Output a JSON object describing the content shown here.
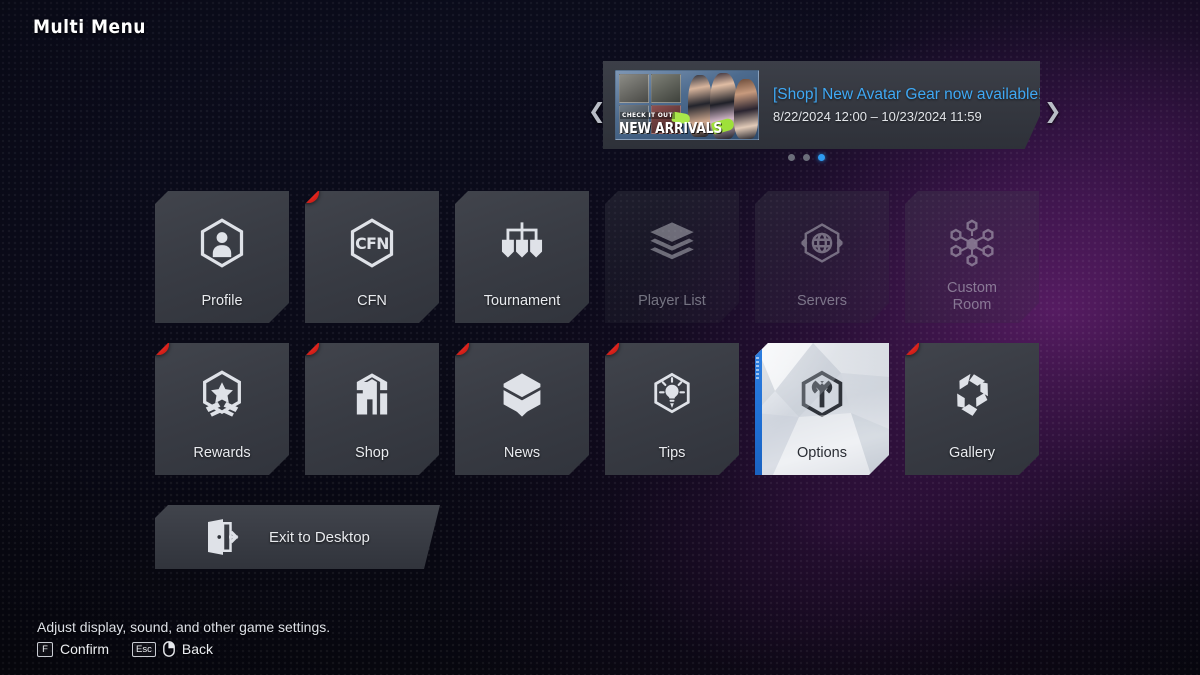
{
  "page": {
    "title": "Multi Menu"
  },
  "banner": {
    "title": "[Shop] New Avatar Gear now available!",
    "date_range": "8/22/2024 12:00 – 10/23/2024 11:59",
    "thumb_kicker": "CHECK IT OUT",
    "thumb_title": "NEW ARRIVALS",
    "prev_icon": "chevron-left-icon",
    "next_icon": "chevron-right-icon",
    "dots": [
      {
        "active": false
      },
      {
        "active": false
      },
      {
        "active": true
      }
    ],
    "accent_color": "#3fa9f5"
  },
  "grid": {
    "row1": [
      {
        "label": "Profile",
        "icon": "profile-icon",
        "state": "enabled",
        "badge": false
      },
      {
        "label": "CFN",
        "icon": "cfn-icon",
        "state": "enabled",
        "badge": true
      },
      {
        "label": "Tournament",
        "icon": "tournament-icon",
        "state": "enabled",
        "badge": false
      },
      {
        "label": "Player List",
        "icon": "player-list-icon",
        "state": "disabled",
        "badge": false
      },
      {
        "label": "Servers",
        "icon": "servers-icon",
        "state": "disabled",
        "badge": false
      },
      {
        "label": "Custom\nRoom",
        "label_line1": "Custom",
        "label_line2": "Room",
        "icon": "custom-room-icon",
        "state": "disabled",
        "badge": false
      }
    ],
    "row2": [
      {
        "label": "Rewards",
        "icon": "rewards-icon",
        "state": "enabled",
        "badge": true
      },
      {
        "label": "Shop",
        "icon": "shop-icon",
        "state": "enabled",
        "badge": true
      },
      {
        "label": "News",
        "icon": "news-icon",
        "state": "enabled",
        "badge": true
      },
      {
        "label": "Tips",
        "icon": "tips-icon",
        "state": "enabled",
        "badge": true
      },
      {
        "label": "Options",
        "icon": "options-icon",
        "state": "selected",
        "badge": false
      },
      {
        "label": "Gallery",
        "icon": "gallery-icon",
        "state": "enabled",
        "badge": true
      }
    ]
  },
  "exit": {
    "label": "Exit to Desktop",
    "icon": "exit-door-icon"
  },
  "footer": {
    "description": "Adjust display, sound, and other game settings.",
    "hints": [
      {
        "key": "F",
        "action": "Confirm",
        "icon": null
      },
      {
        "key": "Esc",
        "action": "Back",
        "icon": "mouse-right-click-icon"
      }
    ]
  },
  "theme": {
    "tile_bg": "#3a3d45",
    "selected_bar": "#2274da",
    "badge_red": "#e0241d",
    "background": "#090a18"
  }
}
